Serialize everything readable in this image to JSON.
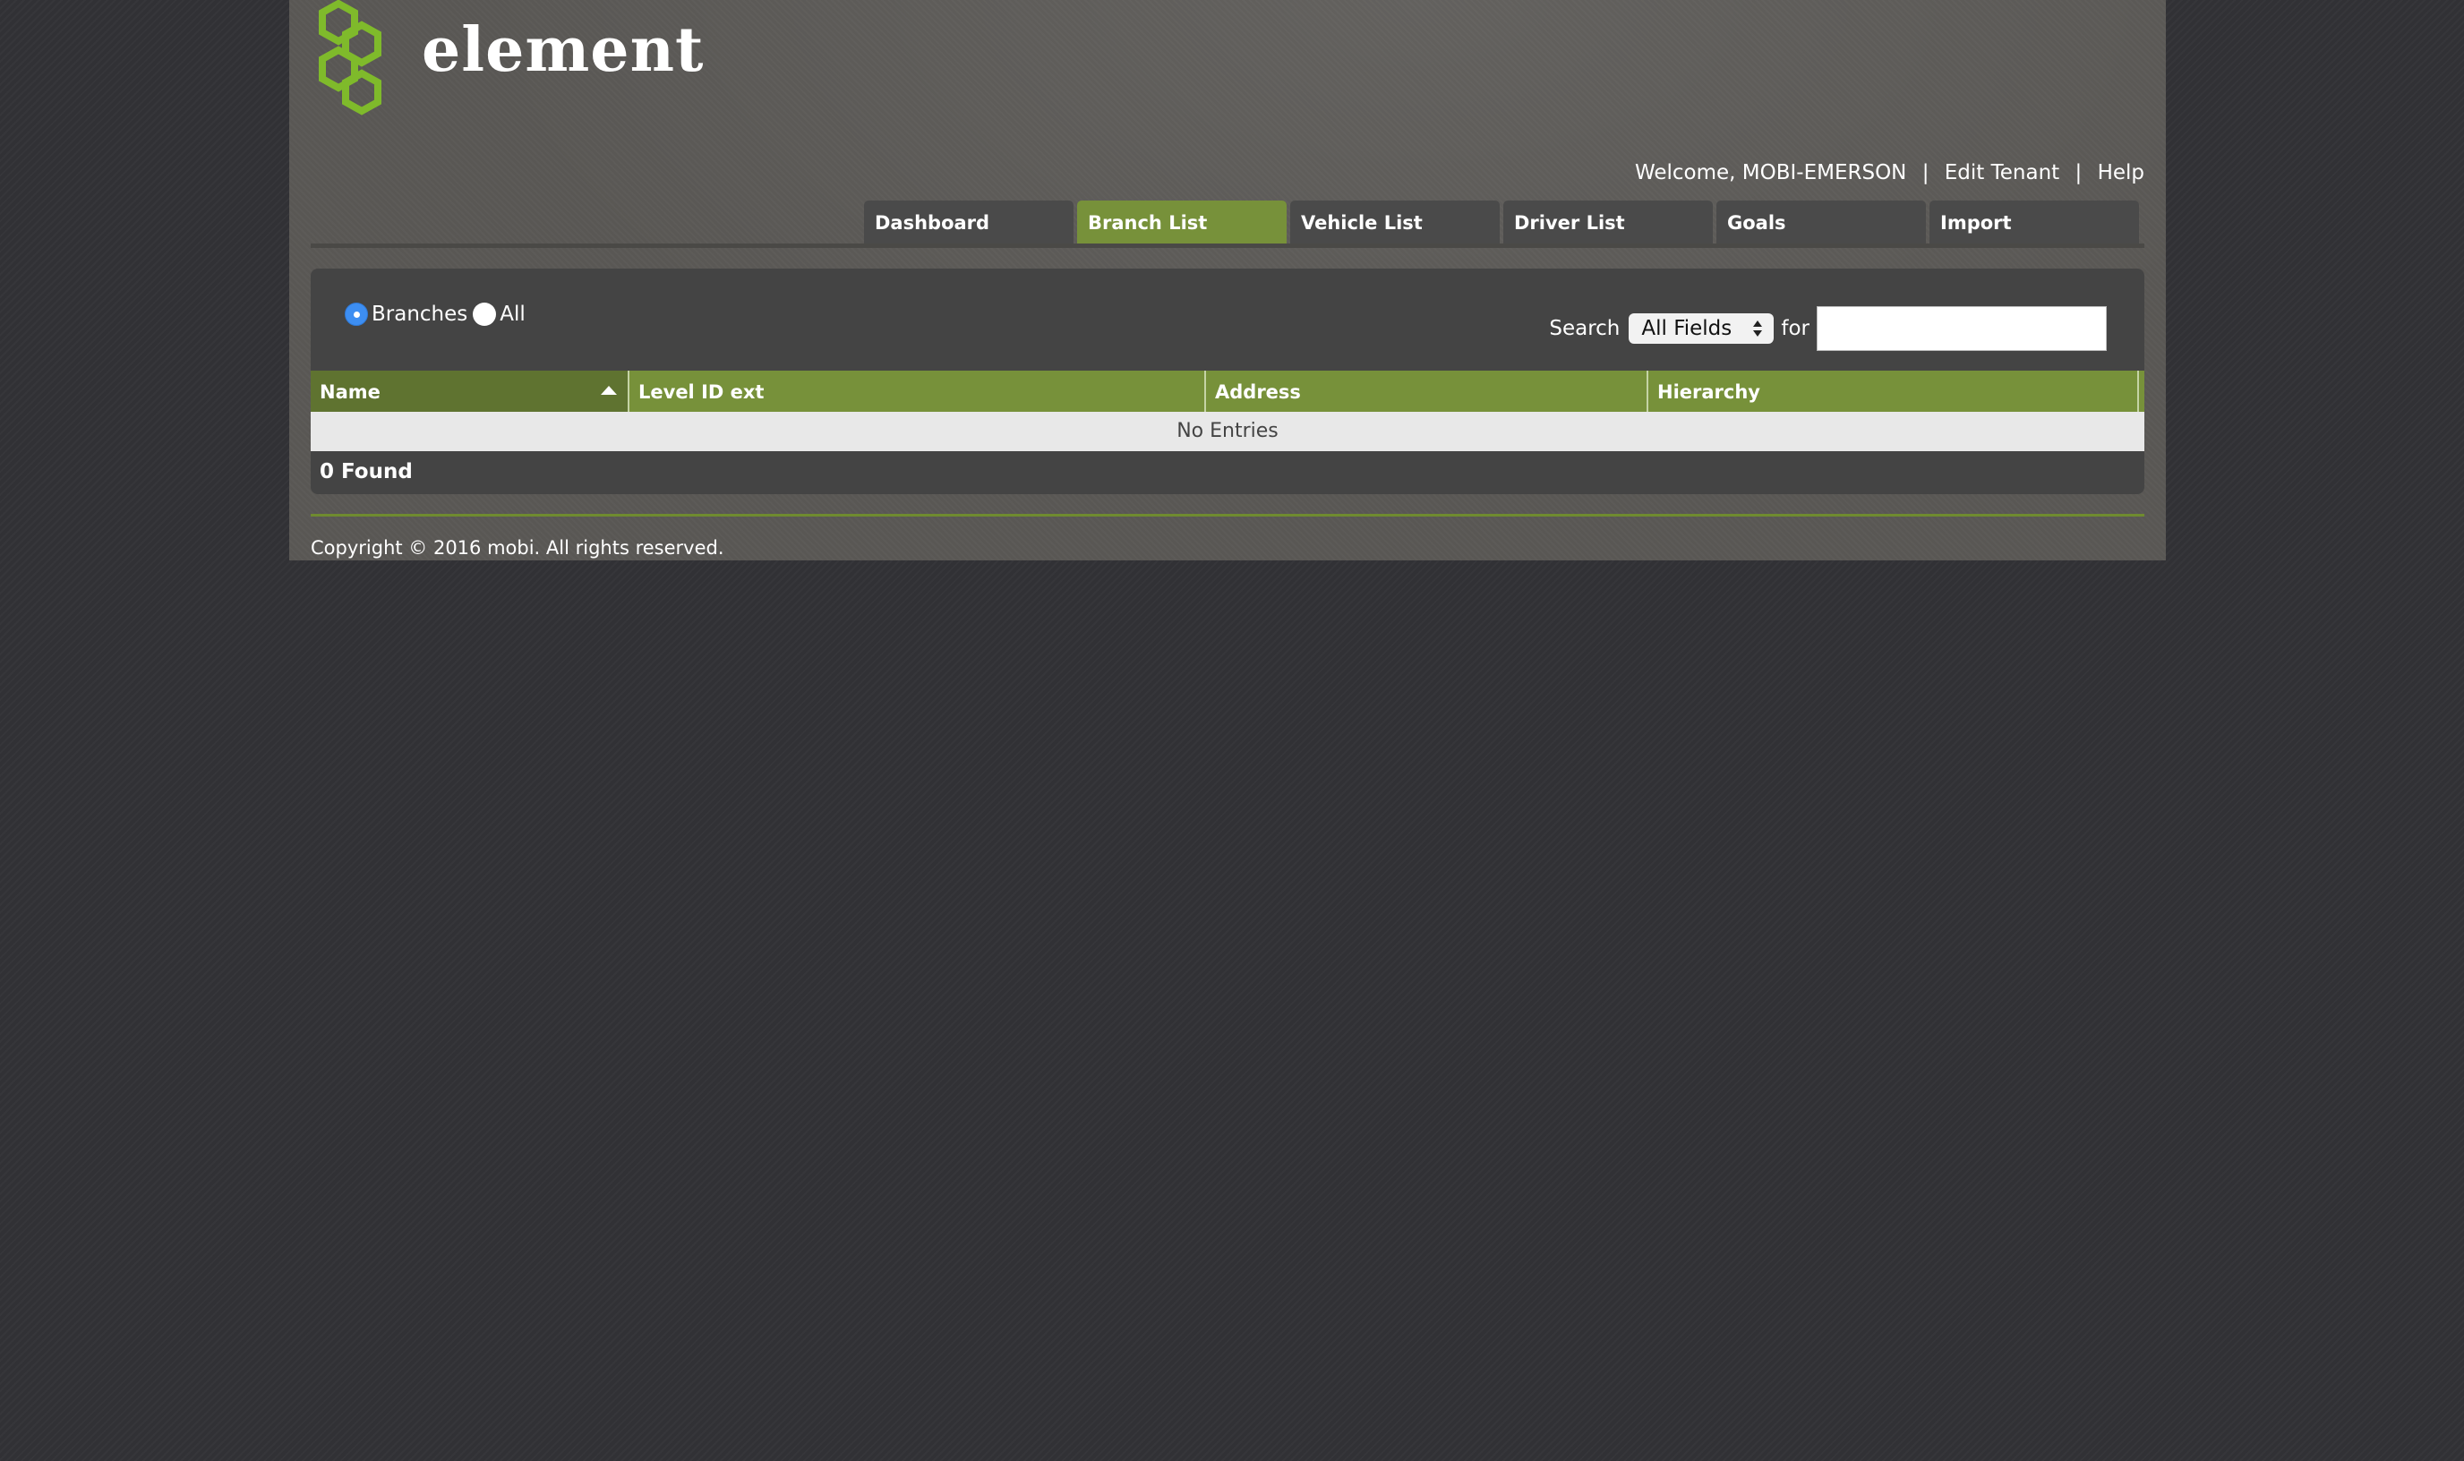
{
  "brand": {
    "name": "element",
    "accent_color": "#77913a",
    "logo_green": "#7fba2b"
  },
  "top_links": {
    "welcome": "Welcome, MOBI-EMERSON",
    "separator": "|",
    "edit_tenant": "Edit Tenant",
    "help": "Help"
  },
  "nav": {
    "tabs": [
      {
        "label": "Dashboard",
        "active": false
      },
      {
        "label": "Branch List",
        "active": true
      },
      {
        "label": "Vehicle List",
        "active": false
      },
      {
        "label": "Driver List",
        "active": false
      },
      {
        "label": "Goals",
        "active": false
      },
      {
        "label": "Import",
        "active": false
      }
    ]
  },
  "filter": {
    "options": [
      {
        "label": "Branches",
        "checked": true
      },
      {
        "label": "All",
        "checked": false
      }
    ]
  },
  "search": {
    "label": "Search",
    "field_selected": "All Fields",
    "for_label": "for",
    "value": ""
  },
  "table": {
    "columns": [
      {
        "label": "Name",
        "sorted": "ascending"
      },
      {
        "label": "Level ID ext"
      },
      {
        "label": "Address"
      },
      {
        "label": "Hierarchy"
      }
    ],
    "empty_message": "No Entries",
    "found_text": "0 Found"
  },
  "footer": {
    "copyright": "Copyright © 2016 mobi. All rights reserved."
  }
}
